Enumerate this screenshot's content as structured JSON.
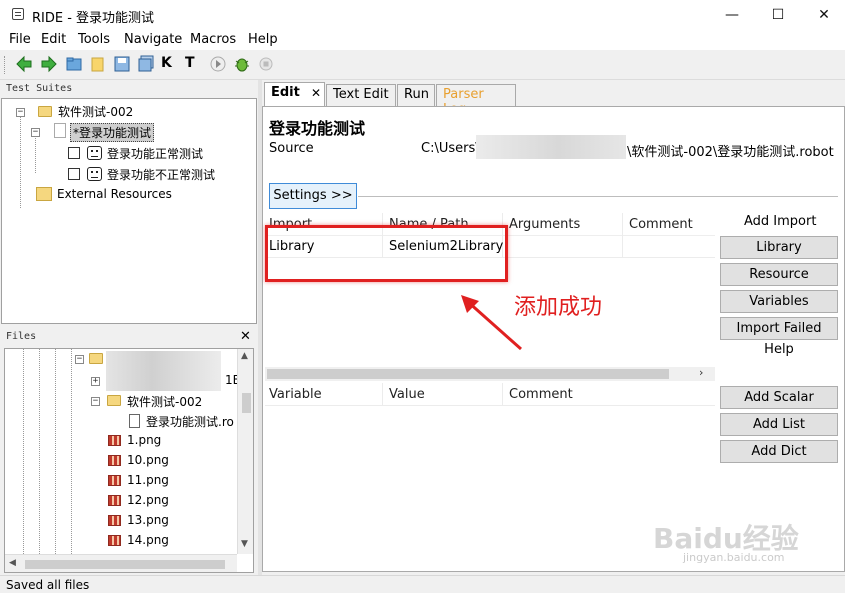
{
  "window": {
    "title": "RIDE - 登录功能测试",
    "minimize": "—",
    "maximize": "☐",
    "close": "✕"
  },
  "menu": [
    "File",
    "Edit",
    "Tools",
    "Navigate",
    "Macros",
    "Help"
  ],
  "toolbar_icons": [
    "back-arrow-icon",
    "forward-arrow-icon",
    "open-folder-icon",
    "folder-icon",
    "save-icon",
    "save-all-icon",
    "keyword-search-icon",
    "test-search-icon",
    "run-icon",
    "debug-bug-icon",
    "stop-icon"
  ],
  "toolbar_glyphs": {
    "keyword": "K",
    "test": "T"
  },
  "test_suites": {
    "title": "Test Suites",
    "nodes": [
      {
        "label": "软件测试-002"
      },
      {
        "label": "*登录功能测试"
      },
      {
        "label": "登录功能正常测试"
      },
      {
        "label": "登录功能不正常测试"
      },
      {
        "label": "External Resources"
      }
    ]
  },
  "files": {
    "title": "Files",
    "close": "✕",
    "partial_label": "1E",
    "folder_label": "软件测试-002",
    "robot_file": "登录功能测试.ro",
    "png_files": [
      "1.png",
      "10.png",
      "11.png",
      "12.png",
      "13.png",
      "14.png"
    ]
  },
  "tabs": [
    {
      "label": "Edit",
      "close": "✕"
    },
    {
      "label": "Text Edit"
    },
    {
      "label": "Run"
    },
    {
      "label": "Parser Log"
    }
  ],
  "editor": {
    "suite_title": "登录功能测试",
    "source_label": "Source",
    "source_prefix": "C:\\Users\\",
    "source_suffix": "\\软件测试-002\\登录功能测试.robot",
    "settings_button": "Settings >>",
    "import_table": {
      "headers": [
        "Import",
        "Name / Path",
        "Arguments",
        "Comment"
      ],
      "rows": [
        [
          "Library",
          "Selenium2Library",
          "",
          ""
        ]
      ]
    },
    "import_buttons": {
      "heading": "Add Import",
      "library": "Library",
      "resource": "Resource",
      "variables": "Variables",
      "import_failed_help": "Import Failed Help"
    },
    "variable_table": {
      "headers": [
        "Variable",
        "Value",
        "Comment"
      ]
    },
    "variable_buttons": {
      "scalar": "Add Scalar",
      "list": "Add List",
      "dict": "Add Dict"
    }
  },
  "annotation": {
    "text": "添加成功",
    "color": "#e02020"
  },
  "status": "Saved all files",
  "watermark": {
    "brand": "Baidu经验",
    "url": "jingyan.baidu.com"
  }
}
